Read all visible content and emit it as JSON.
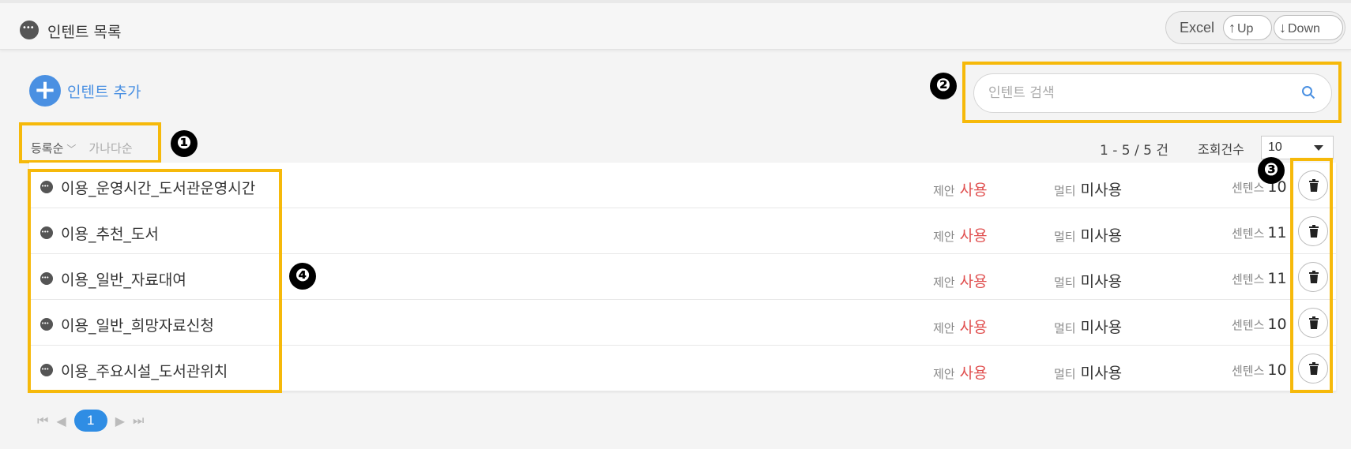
{
  "header": {
    "title": "인텐트 목록"
  },
  "toolbar": {
    "excel_label": "Excel",
    "up_label": "Up",
    "down_label": "Down"
  },
  "add_button": {
    "label": "인텐트 추가"
  },
  "search": {
    "placeholder": "인텐트 검색",
    "value": ""
  },
  "sort": {
    "options": [
      "등록순",
      "가나다순"
    ],
    "selected": "등록순"
  },
  "pagination": {
    "range_text": "1 - 5 / 5 건",
    "page_size_label": "조회건수",
    "page_size": "10",
    "current_page": "1"
  },
  "list_labels": {
    "suggest": "제안",
    "multi": "멀티",
    "sentence": "센텐스"
  },
  "intents": [
    {
      "name": "이용_운영시간_도서관운영시간",
      "suggest": "사용",
      "multi": "미사용",
      "sentences": "10"
    },
    {
      "name": "이용_추천_도서",
      "suggest": "사용",
      "multi": "미사용",
      "sentences": "11"
    },
    {
      "name": "이용_일반_자료대여",
      "suggest": "사용",
      "multi": "미사용",
      "sentences": "11"
    },
    {
      "name": "이용_일반_희망자료신청",
      "suggest": "사용",
      "multi": "미사용",
      "sentences": "10"
    },
    {
      "name": "이용_주요시설_도서관위치",
      "suggest": "사용",
      "multi": "미사용",
      "sentences": "10"
    }
  ],
  "annotations": {
    "m1": "❶",
    "m2": "❷",
    "m3": "❸",
    "m4": "❹"
  },
  "colors": {
    "accent": "#4a90e2",
    "highlight": "#f6b90a",
    "active_value": "#e05050",
    "page_active": "#2f8de4"
  }
}
